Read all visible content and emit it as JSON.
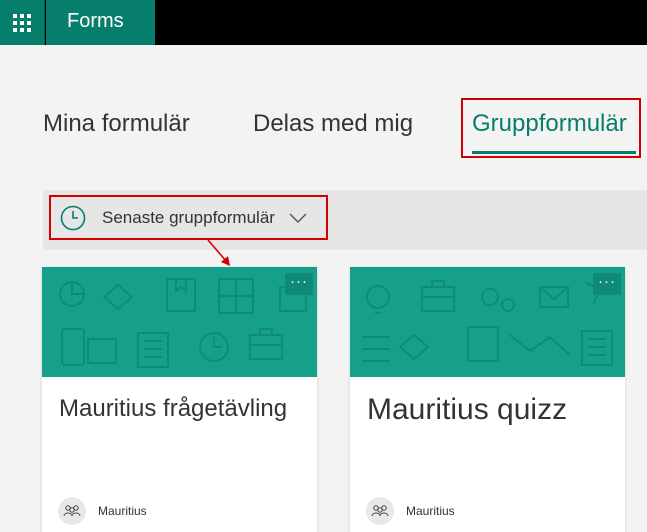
{
  "app": {
    "name": "Forms"
  },
  "tabs": [
    {
      "label": "Mina formulär"
    },
    {
      "label": "Delas med mig"
    },
    {
      "label": "Gruppformulär",
      "active": true
    }
  ],
  "filter": {
    "label": "Senaste gruppformulär"
  },
  "cards": [
    {
      "title": "Mauritius frågetävling",
      "owner": "Mauritius",
      "more_label": "···"
    },
    {
      "title": "Mauritius quizz",
      "owner": "Mauritius",
      "more_label": "···"
    }
  ],
  "colors": {
    "brand": "#077d6c",
    "banner": "#16a08b",
    "highlight": "#d10000"
  },
  "icons": [
    "waffle-icon",
    "clock-icon",
    "chevron-down-icon",
    "more-icon",
    "group-avatar-icon"
  ]
}
